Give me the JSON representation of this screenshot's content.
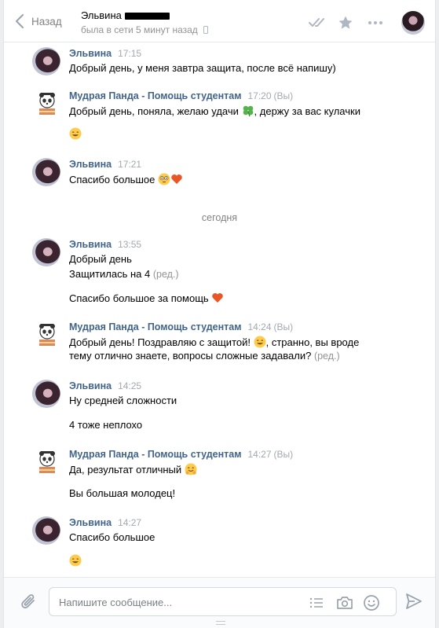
{
  "header": {
    "back_label": "Назад",
    "peer_name": "Эльвина",
    "peer_status": "была в сети 5 минут назад"
  },
  "messages": [
    {
      "author": "Эльвина",
      "time": "17:15",
      "lines": [
        "Добрый день, у меня завтра защита, после всё напишу)"
      ]
    },
    {
      "author": "Мудрая Панда - Помощь студентам",
      "time": "17:20",
      "you": "(Вы)",
      "line1": "Добрый день, поняла, желаю удачи",
      "line1b": ", держу за вас кулачки"
    },
    {
      "author": "Эльвина",
      "time": "17:21",
      "line1": "Спасибо большое"
    },
    {
      "author": "Эльвина",
      "time": "13:55",
      "line1": "Добрый день",
      "line2": "Защитилась на 4",
      "edited": "(ред.)",
      "line3": "Спасибо большое за помощь"
    },
    {
      "author": "Мудрая Панда - Помощь студентам",
      "time": "14:24",
      "you": "(Вы)",
      "line1a": "Добрый день! Поздравляю с защитой!",
      "line1b": ", странно, вы вроде",
      "line2": "тему отлично знаете, вопросы сложные задавали?",
      "edited": "(ред.)"
    },
    {
      "author": "Эльвина",
      "time": "14:25",
      "line1": "Ну средней сложности",
      "line2": "4 тоже неплохо"
    },
    {
      "author": "Мудрая Панда - Помощь студентам",
      "time": "14:27",
      "you": "(Вы)",
      "line1": "Да, результат отличный",
      "line2": "Вы большая молодец!"
    },
    {
      "author": "Эльвина",
      "time": "14:27",
      "line1": "Спасибо большое"
    }
  ],
  "day_separator": "сегодня",
  "composer": {
    "placeholder": "Напишите сообщение..."
  },
  "icons": {
    "back": "chevron-left-icon",
    "read": "double-check-icon",
    "favorite": "star-icon",
    "more": "more-dots-icon",
    "attach": "paperclip-icon",
    "templates": "list-icon",
    "camera": "camera-icon",
    "emoji": "smile-icon",
    "send": "send-icon"
  },
  "colors": {
    "author": "#42648b",
    "muted": "#a3a9b1",
    "icon": "#aeb7c2"
  }
}
